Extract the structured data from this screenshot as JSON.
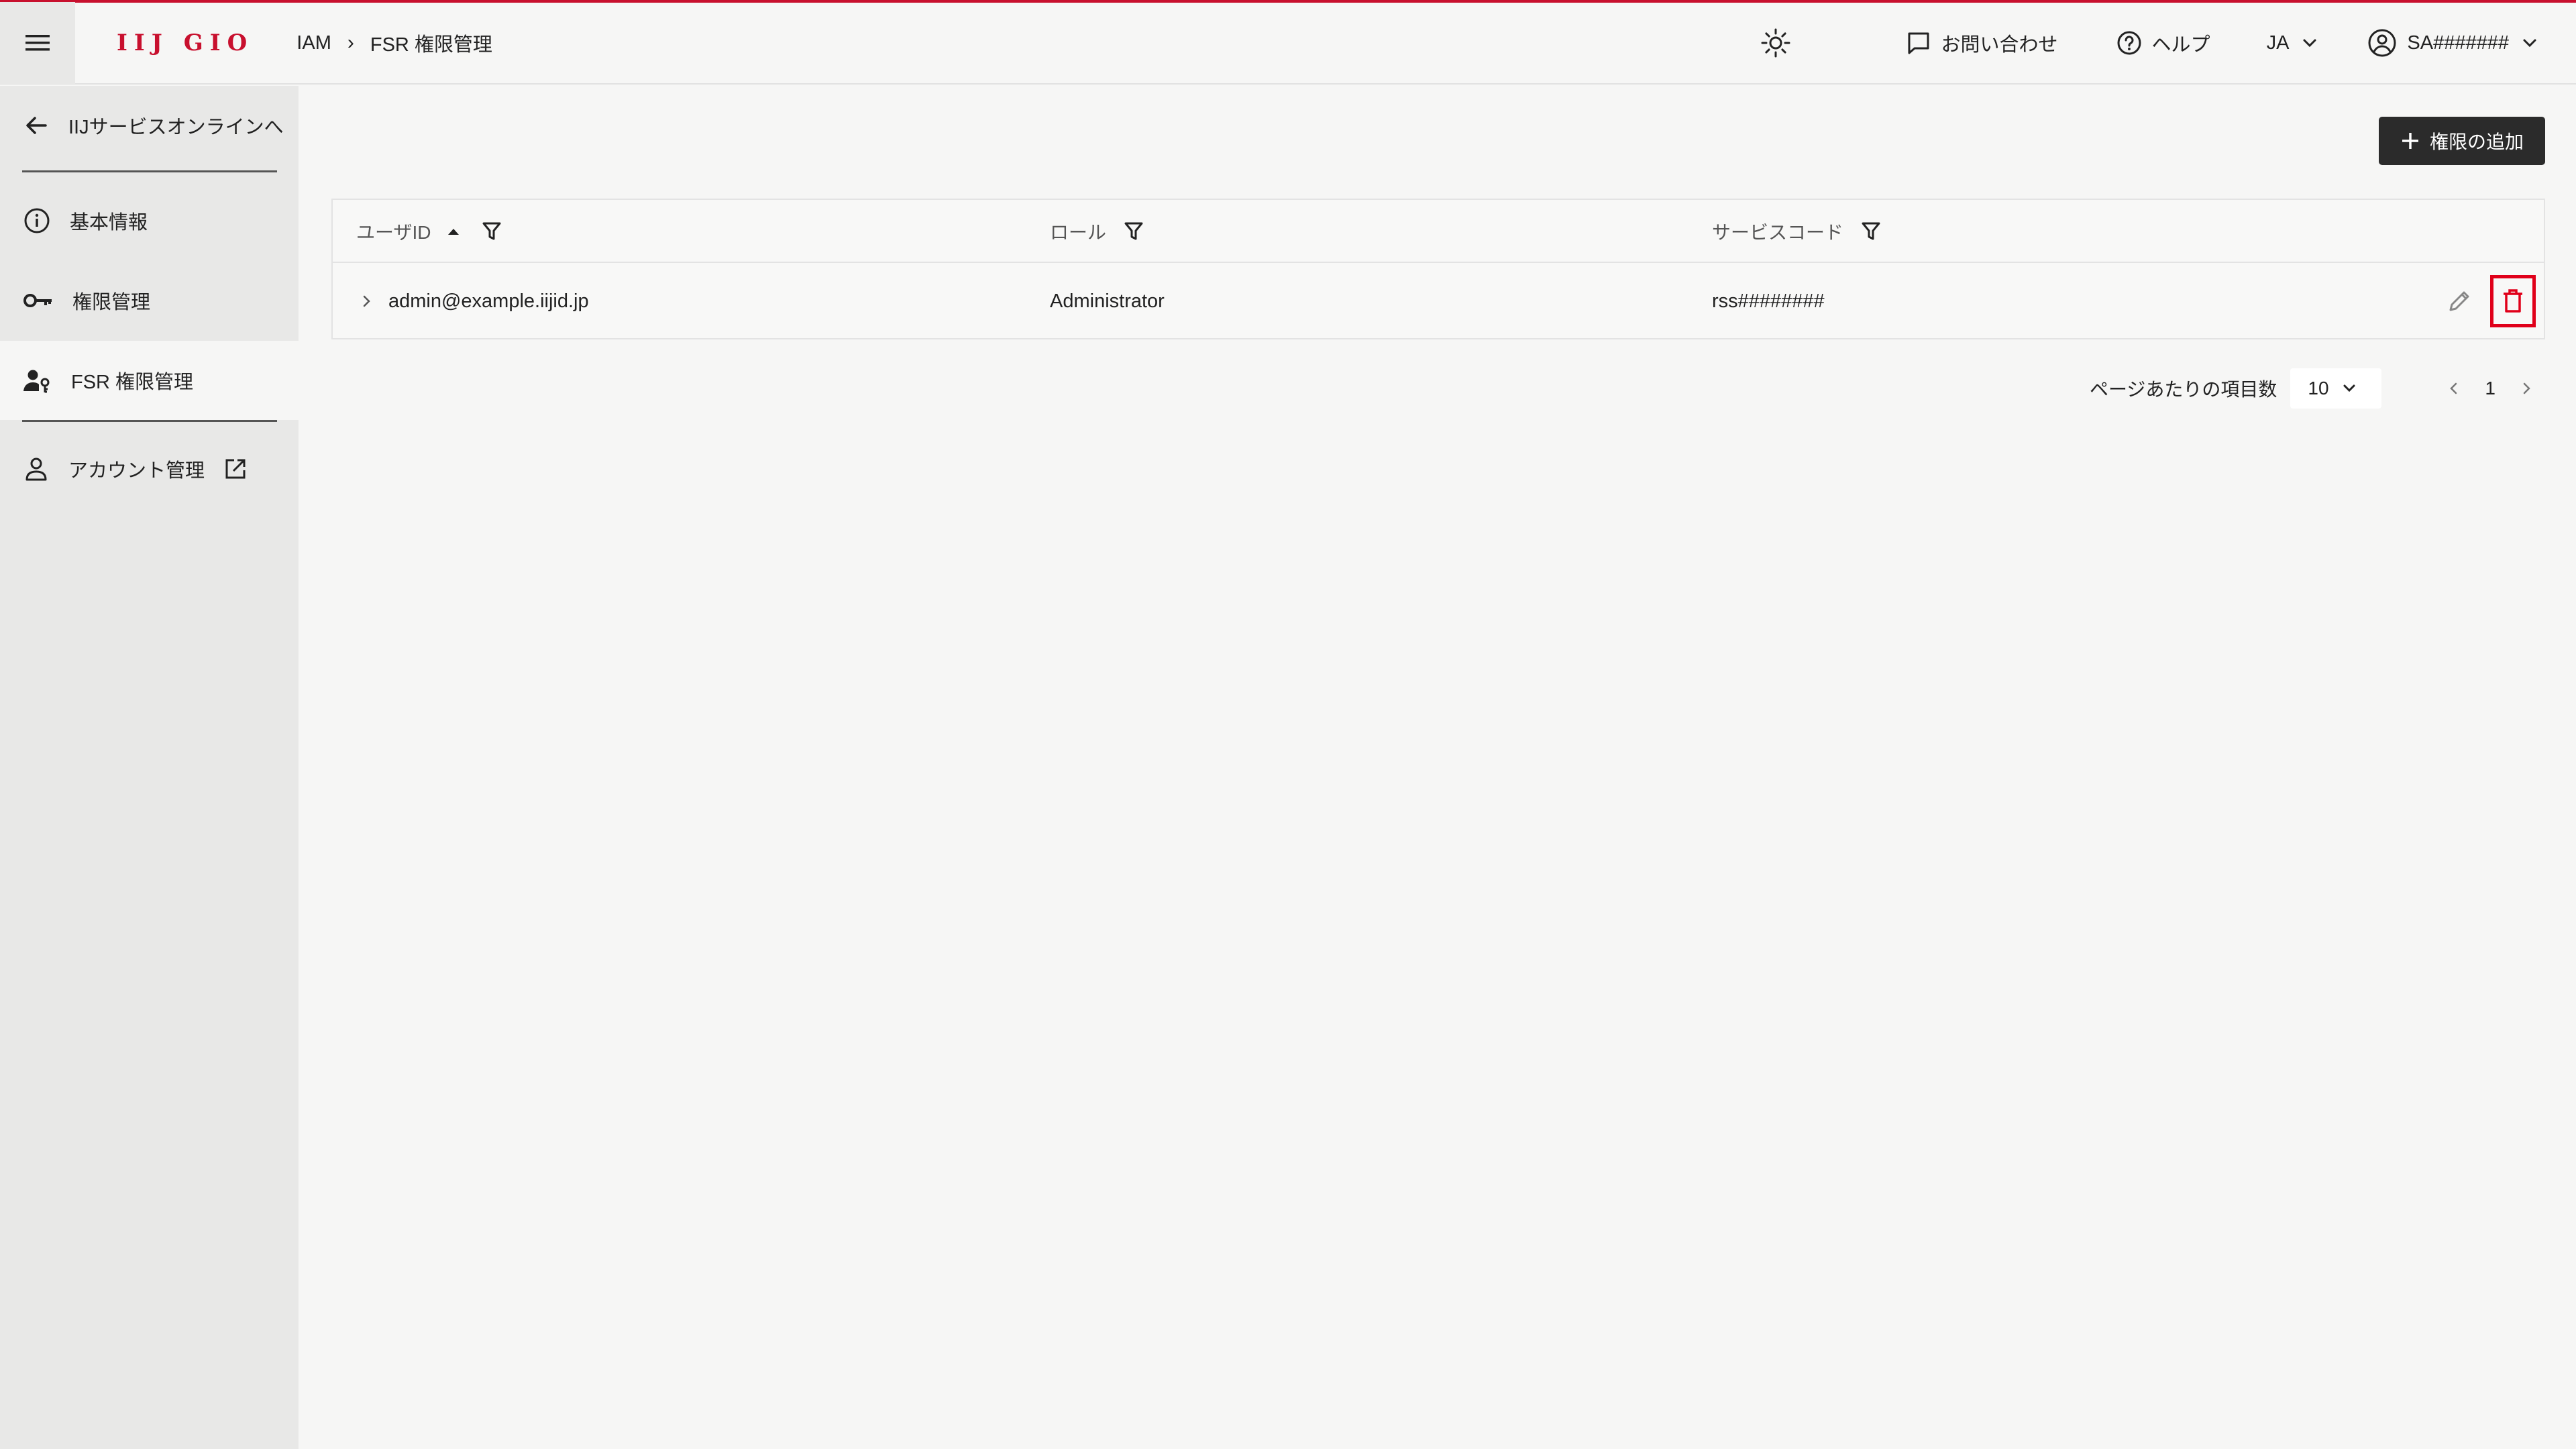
{
  "header": {
    "logo": "IIJ GIO",
    "breadcrumb": [
      "IAM",
      "FSR 権限管理"
    ],
    "breadcrumb_sep": "›",
    "contact_label": "お問い合わせ",
    "help_label": "ヘルプ",
    "language": "JA",
    "user": "SA#######"
  },
  "sidebar": {
    "back_label": "IIJサービスオンラインへ",
    "items": [
      {
        "label": "基本情報",
        "icon": "info-icon"
      },
      {
        "label": "権限管理",
        "icon": "key-icon"
      },
      {
        "label": "FSR 権限管理",
        "icon": "user-key-icon",
        "active": true
      },
      {
        "label": "アカウント管理",
        "icon": "person-icon",
        "external": true
      }
    ]
  },
  "main": {
    "add_button": "権限の追加",
    "table": {
      "columns": [
        "ユーザID",
        "ロール",
        "サービスコード"
      ],
      "rows": [
        {
          "user_id": "admin@example.iijid.jp",
          "role": "Administrator",
          "service_code": "rss########"
        }
      ]
    },
    "pagination": {
      "per_page_label": "ページあたりの項目数",
      "per_page": "10",
      "page": "1"
    }
  },
  "colors": {
    "brand": "#c8102e",
    "highlight": "#e0001a",
    "sidebar_bg": "#e8e8e7",
    "button_bg": "#2b2b2b"
  }
}
